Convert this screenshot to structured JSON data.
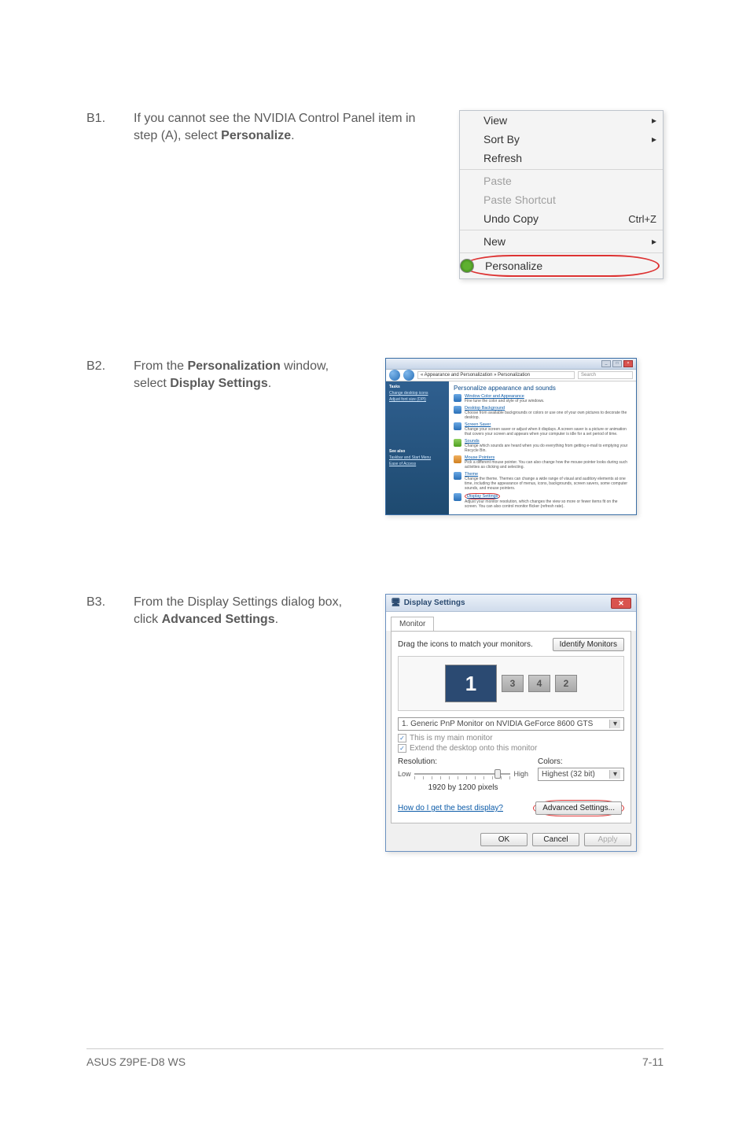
{
  "steps": {
    "b1": {
      "num": "B1.",
      "text_pre": "If you cannot see the NVIDIA Control Panel item in step (A), select ",
      "text_bold": "Personalize",
      "text_post": "."
    },
    "b2": {
      "num": "B2.",
      "text_pre": "From the ",
      "text_bold1": "Personalization",
      "text_mid": " window, select ",
      "text_bold2": "Display Settings",
      "text_post": "."
    },
    "b3": {
      "num": "B3.",
      "text_pre": "From the Display Settings dialog box, click ",
      "text_bold": "Advanced Settings",
      "text_post": "."
    }
  },
  "ctx_menu": {
    "view": "View",
    "sort_by": "Sort By",
    "refresh": "Refresh",
    "paste": "Paste",
    "paste_shortcut": "Paste Shortcut",
    "undo_copy": "Undo Copy",
    "undo_shortcut": "Ctrl+Z",
    "new": "New",
    "personalize": "Personalize"
  },
  "pers": {
    "breadcrumb": "« Appearance and Personalization » Personalization",
    "search_placeholder": "Search",
    "sidebar_tasks": "Tasks",
    "sidebar_change_icons": "Change desktop icons",
    "sidebar_adjust_font": "Adjust font size (DPI)",
    "sidebar_see_also": "See also",
    "sidebar_taskbar": "Taskbar and Start Menu",
    "sidebar_ease": "Ease of Access",
    "title": "Personalize appearance and sounds",
    "items": [
      {
        "t": "Window Color and Appearance",
        "d": "Fine tune the color and style of your windows."
      },
      {
        "t": "Desktop Background",
        "d": "Choose from available backgrounds or colors or use one of your own pictures to decorate the desktop."
      },
      {
        "t": "Screen Saver",
        "d": "Change your screen saver or adjust when it displays. A screen saver is a picture or animation that covers your screen and appears when your computer is idle for a set period of time."
      },
      {
        "t": "Sounds",
        "d": "Change which sounds are heard when you do everything from getting e-mail to emptying your Recycle Bin."
      },
      {
        "t": "Mouse Pointers",
        "d": "Pick a different mouse pointer. You can also change how the mouse pointer looks during such activities as clicking and selecting."
      },
      {
        "t": "Theme",
        "d": "Change the theme. Themes can change a wide range of visual and auditory elements at one time, including the appearance of menus, icons, backgrounds, screen savers, some computer sounds, and mouse pointers."
      },
      {
        "t": "Display Settings",
        "d": "Adjust your monitor resolution, which changes the view so more or fewer items fit on the screen. You can also control monitor flicker (refresh rate)."
      }
    ]
  },
  "ds": {
    "title": "Display Settings",
    "tab_monitor": "Monitor",
    "drag_text": "Drag the icons to match your monitors.",
    "identify_btn": "Identify Monitors",
    "mon_nums": {
      "m1": "1",
      "m3": "3",
      "m4": "4",
      "m2": "2"
    },
    "monitor_select": "1. Generic PnP Monitor on NVIDIA GeForce 8600 GTS",
    "chk_main": "This is my main monitor",
    "chk_extend": "Extend the desktop onto this monitor",
    "res_label": "Resolution:",
    "res_low": "Low",
    "res_high": "High",
    "res_value": "1920 by 1200 pixels",
    "colors_label": "Colors:",
    "colors_value": "Highest (32 bit)",
    "best_link": "How do I get the best display?",
    "advanced_btn": "Advanced Settings...",
    "ok": "OK",
    "cancel": "Cancel",
    "apply": "Apply",
    "close_x": "✕"
  },
  "footer": {
    "left": "ASUS Z9PE-D8 WS",
    "right": "7-11"
  }
}
